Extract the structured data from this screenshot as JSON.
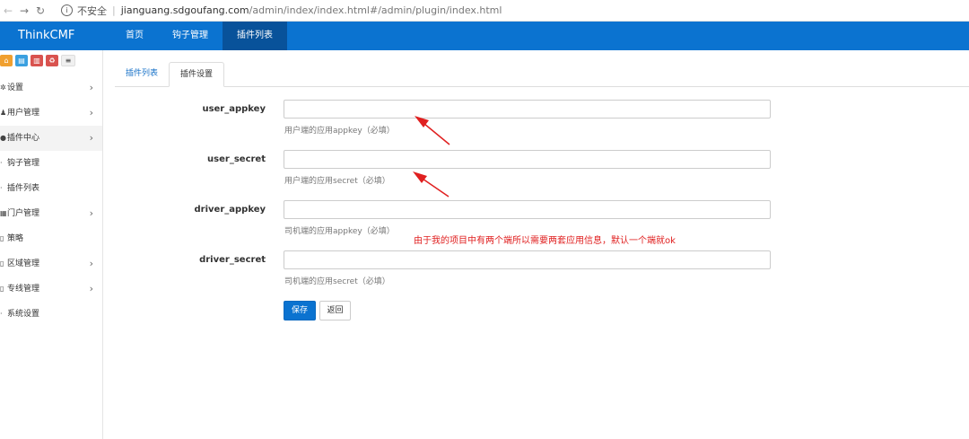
{
  "browser": {
    "insecure_label": "不安全",
    "url_host": "jianguang.sdgoufang.com",
    "url_path": "/admin/index/index.html#/admin/plugin/index.html"
  },
  "topnav": {
    "brand": "ThinkCMF",
    "items": [
      {
        "label": "首页",
        "active": false
      },
      {
        "label": "钩子管理",
        "active": false
      },
      {
        "label": "插件列表",
        "active": true
      }
    ]
  },
  "sidebar": {
    "quick_buttons": [
      "home-icon",
      "document-icon",
      "trash-icon",
      "refresh-icon",
      "list-icon"
    ],
    "items": [
      {
        "label": "设置",
        "icon": "cog-icon",
        "arrow": true
      },
      {
        "label": "用户管理",
        "icon": "users-icon",
        "arrow": true
      },
      {
        "label": "插件中心",
        "icon": "cloud-icon",
        "arrow": true,
        "active": true
      },
      {
        "label": "钩子管理",
        "icon": "bullet-icon",
        "arrow": false
      },
      {
        "label": "插件列表",
        "icon": "bullet-icon",
        "arrow": false
      },
      {
        "label": "门户管理",
        "icon": "th-icon",
        "arrow": true
      },
      {
        "label": "策略",
        "icon": "file-icon",
        "arrow": false
      },
      {
        "label": "区域管理",
        "icon": "file-icon",
        "arrow": true
      },
      {
        "label": "专线管理",
        "icon": "file-icon",
        "arrow": true
      },
      {
        "label": "系统设置",
        "icon": "bullet-icon",
        "arrow": false
      }
    ]
  },
  "tabs": [
    {
      "label": "插件列表",
      "active": false
    },
    {
      "label": "插件设置",
      "active": true
    }
  ],
  "form": {
    "fields": [
      {
        "label": "user_appkey",
        "value": "",
        "help": "用户端的应用appkey（必填）"
      },
      {
        "label": "user_secret",
        "value": "",
        "help": "用户端的应用secret（必填）"
      },
      {
        "label": "driver_appkey",
        "value": "",
        "help": "司机端的应用appkey（必填）"
      },
      {
        "label": "driver_secret",
        "value": "",
        "help": "司机端的应用secret（必填）"
      }
    ],
    "save_label": "保存",
    "back_label": "返回"
  },
  "annotation": {
    "note": "由于我的项目中有两个端所以需要两套应用信息，默认一个端就ok",
    "color": "#e02020"
  },
  "colors": {
    "primary": "#0b73d0",
    "active_nav": "#08529a"
  }
}
